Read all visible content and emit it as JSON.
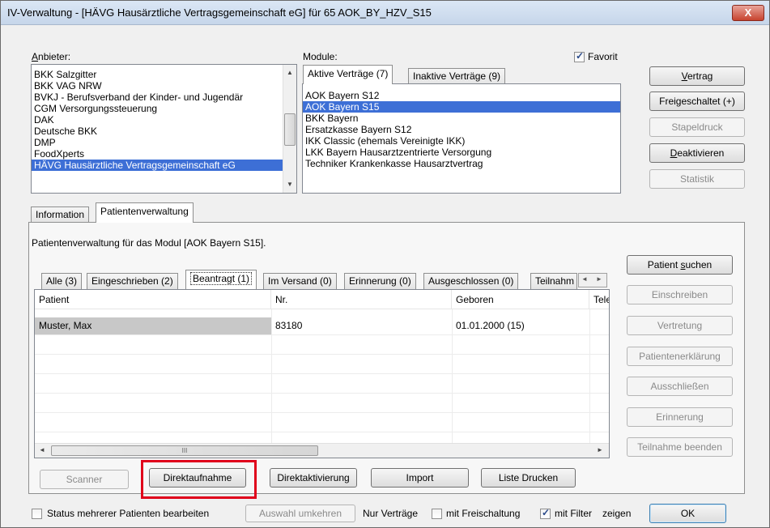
{
  "window": {
    "title": "IV-Verwaltung - [HÄVG Hausärztliche Vertragsgemeinschaft eG] für 65 AOK_BY_HZV_S15",
    "close_label": "X"
  },
  "anbieter": {
    "label": "Anbieter:",
    "items": [
      "BKK Salzgitter",
      "BKK VAG NRW",
      "BVKJ - Berufsverband der Kinder- und Jugendär",
      "CGM Versorgungssteuerung",
      "DAK",
      "Deutsche BKK",
      "DMP",
      "FoodXperts",
      "HÄVG Hausärztliche Vertragsgemeinschaft eG"
    ]
  },
  "module": {
    "label": "Module:",
    "favorit_label": "Favorit",
    "tabs": [
      "Aktive Verträge (7)",
      "Inaktive Verträge (9)"
    ],
    "items": [
      "AOK Bayern S12",
      "AOK Bayern S15",
      "BKK Bayern",
      "Ersatzkasse Bayern S12",
      "IKK Classic (ehemals Vereinigte IKK)",
      "LKK Bayern Hausarztzentrierte Versorgung",
      "Techniker Krankenkasse Hausarztvertrag"
    ]
  },
  "right_buttons": [
    "Vertrag",
    "Freigeschaltet (+)",
    "Stapeldruck",
    "Deaktivieren",
    "Statistik"
  ],
  "main_tabs": [
    "Information",
    "Patientenverwaltung"
  ],
  "patient_panel": {
    "heading": "Patientenverwaltung für das Modul [AOK Bayern S15].",
    "sub_tabs": [
      "Alle (3)",
      "Eingeschrieben (2)",
      "Beantragt (1)",
      "Im Versand (0)",
      "Erinnerung (0)",
      "Ausgeschlossen (0)",
      "Teilnahm"
    ],
    "columns": [
      "Patient",
      "Nr.",
      "Geboren",
      "Tele"
    ],
    "rows": [
      {
        "patient": "Muster, Max",
        "nr": "83180",
        "geboren": "01.01.2000 (15)"
      }
    ],
    "side_buttons": [
      "Patient suchen",
      "Einschreiben",
      "Vertretung",
      "Patientenerklärung",
      "Ausschließen",
      "Erinnerung",
      "Teilnahme beenden"
    ],
    "bottom_buttons": [
      "Scanner",
      "Direktaufnahme",
      "Direktaktivierung",
      "Import",
      "Liste Drucken"
    ],
    "hscroll_grip": "III"
  },
  "footer": {
    "status_check_label": "Status mehrerer Patienten bearbeiten",
    "auswahl_label": "Auswahl umkehren",
    "nur_label": "Nur Verträge",
    "freischaltung_label": "mit Freischaltung",
    "filter_label": "mit Filter",
    "zeigen_label": "zeigen",
    "ok_label": "OK"
  },
  "colors": {
    "selection": "#3399ff",
    "highlight_box": "#e0001b"
  }
}
